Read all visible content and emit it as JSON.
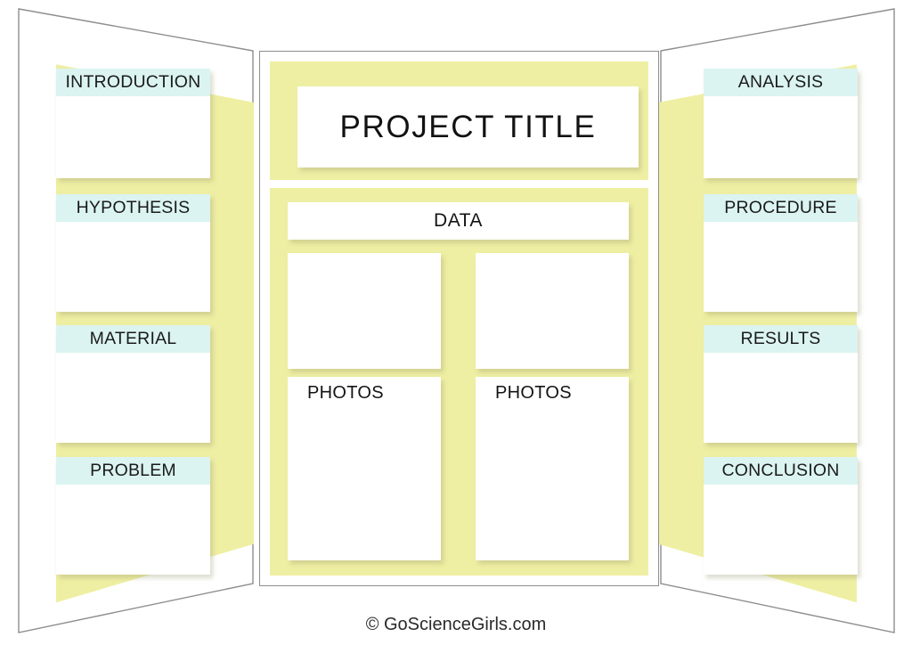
{
  "board": {
    "kind": "science-fair-trifold-board-template",
    "background_color": "#ffffff",
    "panel_fill_color": "#efefa3",
    "section_header_color": "#dbf4f1",
    "card_color": "#ffffff",
    "outline_color": "#8e8e8e"
  },
  "left_panel": {
    "sections": [
      {
        "label": "INTRODUCTION"
      },
      {
        "label": "HYPOTHESIS"
      },
      {
        "label": "MATERIAL"
      },
      {
        "label": "PROBLEM"
      }
    ]
  },
  "center_panel": {
    "title": "PROJECT TITLE",
    "data_label": "DATA",
    "photo_labels": [
      "PHOTOS",
      "PHOTOS"
    ]
  },
  "right_panel": {
    "sections": [
      {
        "label": "ANALYSIS"
      },
      {
        "label": "PROCEDURE"
      },
      {
        "label": "RESULTS"
      },
      {
        "label": "CONCLUSION"
      }
    ]
  },
  "footer": {
    "credit": "© GoScienceGirls.com"
  }
}
